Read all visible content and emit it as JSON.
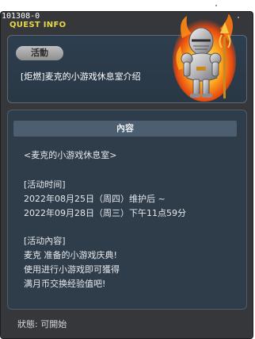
{
  "window": {
    "quest_id": "101308-0",
    "title": "QUEST INFO"
  },
  "header": {
    "badge": "活動",
    "quest_title": "[炬燃]麦克的小游戏休息室介绍"
  },
  "content": {
    "header": "內容",
    "lines": [
      "<麦克的小游戏休息室>",
      "[活动时间]",
      "2022年08月25日（周四）维护后 ~",
      "2022年09月28日（周三）下午11点59分",
      "[活动內容]",
      "麦克 准备的小游戏庆典!",
      "使用进行小游戏即可獲得",
      "满月币交换经验值吧!"
    ]
  },
  "status": {
    "text": "狀態:  可開始"
  },
  "icons": {
    "portrait": "flaming-knight-icon"
  },
  "colors": {
    "title_yellow": "#e6d94a",
    "window_bg": "#36373b",
    "panel_bg": "#2f3d4b",
    "content_header_bg": "#4c5e6f"
  }
}
